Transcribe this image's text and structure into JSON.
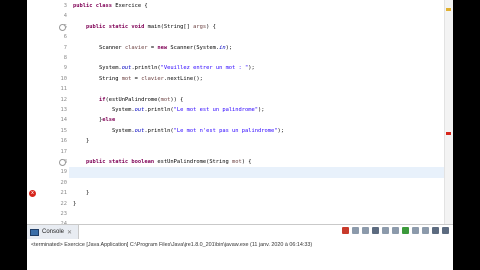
{
  "editor": {
    "lines": [
      {
        "num": "3",
        "parts": [
          {
            "t": "kw",
            "v": "public class"
          },
          {
            "t": "txt",
            "v": " Exercice {"
          }
        ]
      },
      {
        "num": "4",
        "parts": []
      },
      {
        "num": "5",
        "parts": [
          {
            "t": "txt",
            "v": "    "
          },
          {
            "t": "kw",
            "v": "public static void"
          },
          {
            "t": "txt",
            "v": " main(String[] "
          },
          {
            "t": "var",
            "v": "args"
          },
          {
            "t": "txt",
            "v": ") {"
          }
        ]
      },
      {
        "num": "6",
        "parts": []
      },
      {
        "num": "7",
        "parts": [
          {
            "t": "txt",
            "v": "        Scanner "
          },
          {
            "t": "var",
            "v": "clavier"
          },
          {
            "t": "txt",
            "v": " = "
          },
          {
            "t": "kw",
            "v": "new"
          },
          {
            "t": "txt",
            "v": " Scanner(System."
          },
          {
            "t": "fld",
            "v": "in"
          },
          {
            "t": "txt",
            "v": ");"
          }
        ]
      },
      {
        "num": "8",
        "parts": []
      },
      {
        "num": "9",
        "parts": [
          {
            "t": "txt",
            "v": "        System."
          },
          {
            "t": "fld",
            "v": "out"
          },
          {
            "t": "txt",
            "v": ".println("
          },
          {
            "t": "str",
            "v": "\"Veuillez entrer un mot : \""
          },
          {
            "t": "txt",
            "v": ");"
          }
        ]
      },
      {
        "num": "10",
        "parts": [
          {
            "t": "txt",
            "v": "        String "
          },
          {
            "t": "var",
            "v": "mot"
          },
          {
            "t": "txt",
            "v": " = "
          },
          {
            "t": "var",
            "v": "clavier"
          },
          {
            "t": "txt",
            "v": ".nextLine();"
          }
        ]
      },
      {
        "num": "11",
        "parts": []
      },
      {
        "num": "12",
        "parts": [
          {
            "t": "txt",
            "v": "        "
          },
          {
            "t": "kw",
            "v": "if"
          },
          {
            "t": "txt",
            "v": "(estUnPalindrome("
          },
          {
            "t": "var",
            "v": "mot"
          },
          {
            "t": "txt",
            "v": ")) {"
          }
        ]
      },
      {
        "num": "13",
        "parts": [
          {
            "t": "txt",
            "v": "            System."
          },
          {
            "t": "fld",
            "v": "out"
          },
          {
            "t": "txt",
            "v": ".println("
          },
          {
            "t": "str",
            "v": "\"Le mot est un palindrome\""
          },
          {
            "t": "txt",
            "v": ");"
          }
        ]
      },
      {
        "num": "14",
        "parts": [
          {
            "t": "txt",
            "v": "        }"
          },
          {
            "t": "kw",
            "v": "else"
          }
        ]
      },
      {
        "num": "15",
        "parts": [
          {
            "t": "txt",
            "v": "            System."
          },
          {
            "t": "fld",
            "v": "out"
          },
          {
            "t": "txt",
            "v": ".println("
          },
          {
            "t": "str",
            "v": "\"Le mot n'est pas un palindrome\""
          },
          {
            "t": "txt",
            "v": ");"
          }
        ]
      },
      {
        "num": "16",
        "parts": [
          {
            "t": "txt",
            "v": "    }"
          }
        ]
      },
      {
        "num": "17",
        "parts": []
      },
      {
        "num": "18",
        "parts": [
          {
            "t": "txt",
            "v": "    "
          },
          {
            "t": "kw",
            "v": "public static boolean"
          },
          {
            "t": "txt",
            "v": " estUnPalindrome(String "
          },
          {
            "t": "var",
            "v": "mot"
          },
          {
            "t": "txt",
            "v": ") {"
          }
        ]
      },
      {
        "num": "19",
        "parts": []
      },
      {
        "num": "20",
        "parts": []
      },
      {
        "num": "21",
        "parts": [
          {
            "t": "txt",
            "v": "    }"
          }
        ]
      },
      {
        "num": "22",
        "parts": [
          {
            "t": "txt",
            "v": "}"
          }
        ]
      },
      {
        "num": "23",
        "parts": []
      },
      {
        "num": "24",
        "parts": []
      }
    ],
    "highlight_line": "19",
    "error_line": "21",
    "error_marker": "x"
  },
  "console": {
    "tab_label": "Console",
    "close_glyph": "✕",
    "status": "<terminated> Exercice [Java Application] C:\\Program Files\\Java\\jre1.8.0_201\\bin\\javaw.exe (11 janv. 2020 à 06:14:33)"
  },
  "colors": {
    "keyword": "#7f0055",
    "string": "#2a00ff",
    "field": "#0000c0",
    "variable": "#6a3e3e",
    "line_highlight": "#e8f1fb"
  }
}
